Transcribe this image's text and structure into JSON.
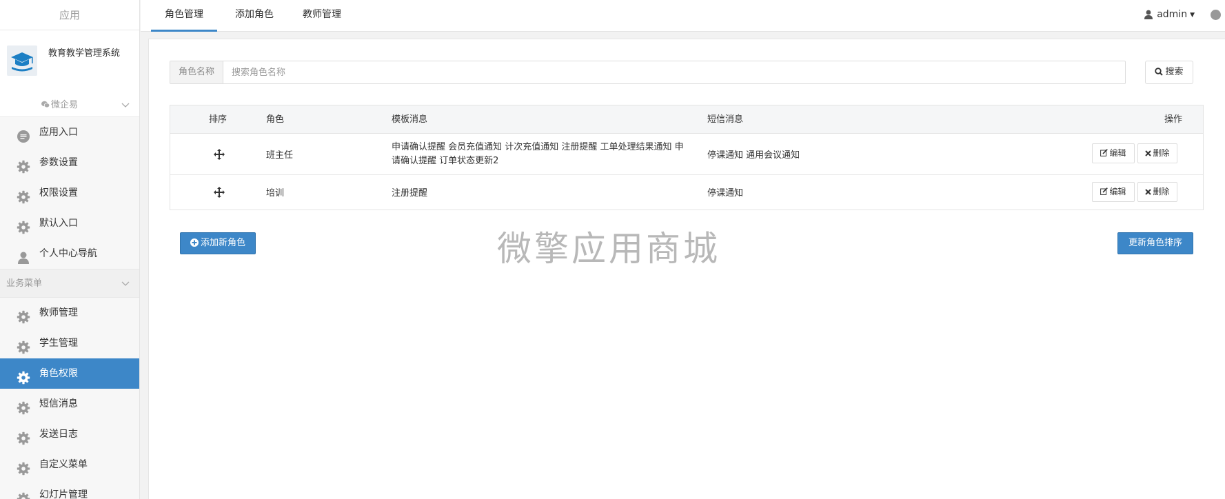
{
  "sidebar": {
    "app_label": "应用",
    "brand_name": "教育教学管理系统",
    "group_wechat": "微企易",
    "items_top": [
      {
        "label": "应用入口",
        "icon": "chat-icon"
      },
      {
        "label": "参数设置",
        "icon": "gear-icon"
      },
      {
        "label": "权限设置",
        "icon": "gear-icon"
      },
      {
        "label": "默认入口",
        "icon": "gear-icon"
      },
      {
        "label": "个人中心导航",
        "icon": "user-icon"
      }
    ],
    "group_business": "业务菜单",
    "items_business": [
      {
        "label": "教师管理",
        "icon": "gear-icon"
      },
      {
        "label": "学生管理",
        "icon": "gear-icon"
      },
      {
        "label": "角色权限",
        "icon": "gear-icon",
        "active": true
      },
      {
        "label": "短信消息",
        "icon": "gear-icon"
      },
      {
        "label": "发送日志",
        "icon": "gear-icon"
      },
      {
        "label": "自定义菜单",
        "icon": "gear-icon"
      },
      {
        "label": "幻灯片管理",
        "icon": "gear-icon"
      }
    ]
  },
  "topbar": {
    "tabs": [
      "角色管理",
      "添加角色",
      "教师管理"
    ],
    "active_tab": "角色管理",
    "user": "admin"
  },
  "search": {
    "addon_label": "角色名称",
    "placeholder": "搜索角色名称",
    "value": "",
    "button_label": "搜索"
  },
  "table": {
    "headers": [
      "排序",
      "角色",
      "模板消息",
      "短信消息",
      "操作"
    ],
    "rows": [
      {
        "role": "班主任",
        "template_msg": "申请确认提醒 会员充值通知 计次充值通知 注册提醒 工单处理结果通知 申请确认提醒 订单状态更新2",
        "sms_msg": "停课通知 通用会议通知",
        "edit_label": "编辑",
        "delete_label": "删除"
      },
      {
        "role": "培训",
        "template_msg": "注册提醒",
        "sms_msg": "停课通知",
        "edit_label": "编辑",
        "delete_label": "删除"
      }
    ]
  },
  "actions": {
    "add_role_label": "添加新角色",
    "update_sort_label": "更新角色排序"
  },
  "watermark": "微擎应用商城",
  "colors": {
    "primary": "#3d87c8",
    "sidebar_bg": "#f7f7f7",
    "page_bg": "#f2f2f2"
  }
}
